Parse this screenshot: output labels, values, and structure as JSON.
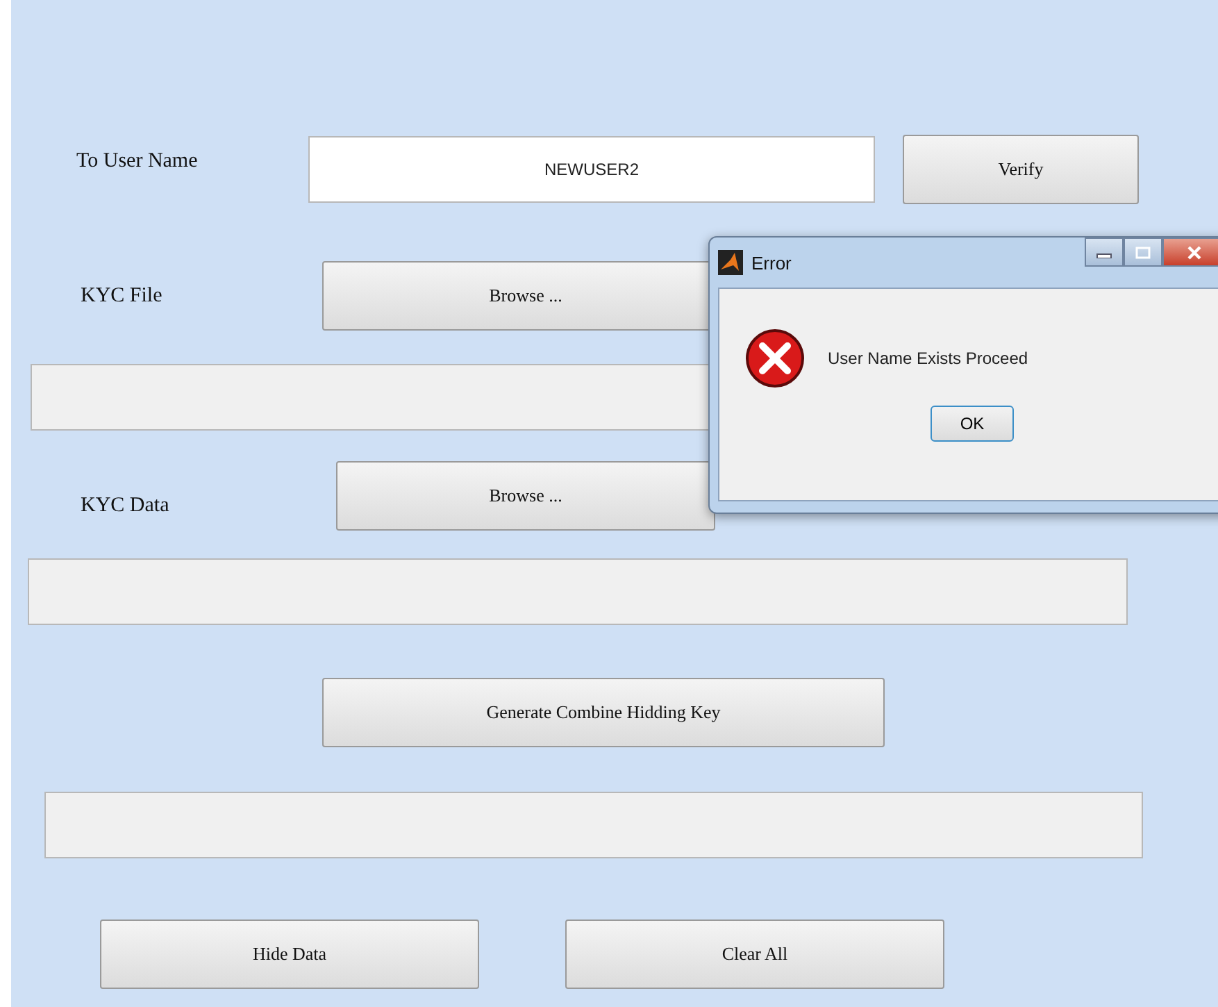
{
  "form": {
    "user_label": "To User Name",
    "user_value": "NEWUSER2",
    "verify_button": "Verify",
    "kyc_file_label": "KYC File",
    "kyc_file_button": "Browse ...",
    "kyc_data_label": "KYC Data",
    "kyc_data_button": "Browse ...",
    "generate_button": "Generate Combine Hidding Key",
    "hide_button": "Hide Data",
    "clear_button": "Clear All"
  },
  "dialog": {
    "title": "Error",
    "message": "User Name Exists Proceed",
    "button": "OK"
  }
}
